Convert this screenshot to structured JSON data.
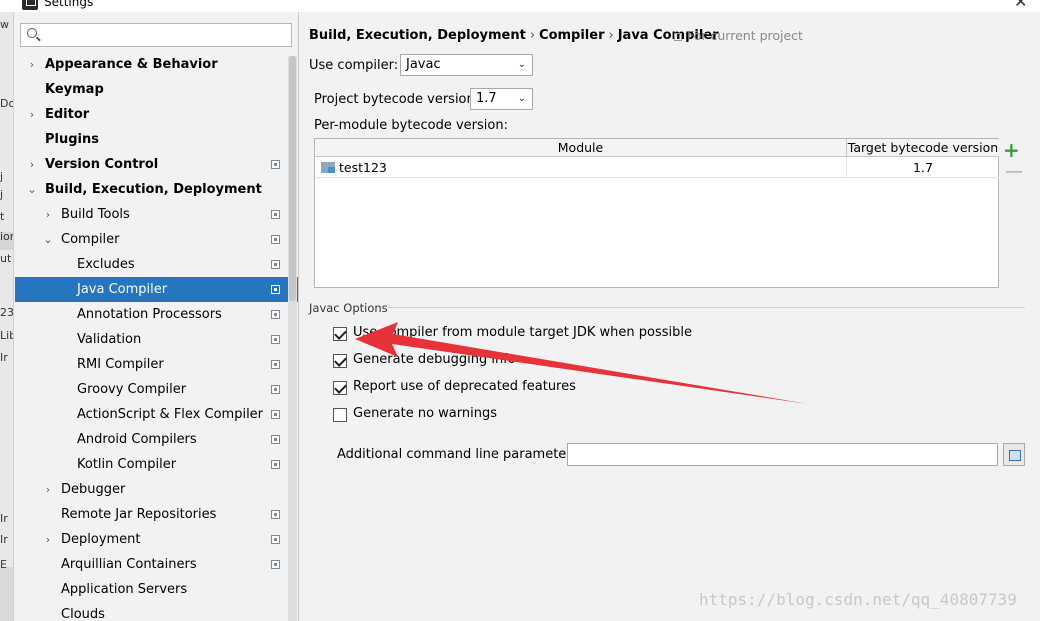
{
  "window": {
    "title": "Settings"
  },
  "search": {
    "placeholder": ""
  },
  "background_fragments": [
    "w",
    "Dom",
    "j",
    "j",
    "t",
    "ion",
    "ut",
    "23",
    "Lib",
    "Ir",
    "Ir",
    "Ir",
    "E"
  ],
  "sidebar": {
    "items": [
      {
        "label": "Appearance & Behavior",
        "bold": true,
        "chevron": "›",
        "project_icon": false
      },
      {
        "label": "Keymap",
        "bold": true,
        "chevron": "",
        "project_icon": false
      },
      {
        "label": "Editor",
        "bold": true,
        "chevron": "›",
        "project_icon": false
      },
      {
        "label": "Plugins",
        "bold": true,
        "chevron": "",
        "project_icon": false
      },
      {
        "label": "Version Control",
        "bold": true,
        "chevron": "›",
        "project_icon": true
      },
      {
        "label": "Build, Execution, Deployment",
        "bold": true,
        "chevron": "⌄",
        "project_icon": false
      },
      {
        "label": "Build Tools",
        "bold": false,
        "chevron": "›",
        "project_icon": true
      },
      {
        "label": "Compiler",
        "bold": false,
        "chevron": "⌄",
        "project_icon": true
      },
      {
        "label": "Excludes",
        "bold": false,
        "chevron": "",
        "project_icon": true
      },
      {
        "label": "Java Compiler",
        "bold": false,
        "chevron": "",
        "project_icon": true,
        "selected": true
      },
      {
        "label": "Annotation Processors",
        "bold": false,
        "chevron": "",
        "project_icon": true
      },
      {
        "label": "Validation",
        "bold": false,
        "chevron": "",
        "project_icon": true
      },
      {
        "label": "RMI Compiler",
        "bold": false,
        "chevron": "",
        "project_icon": true
      },
      {
        "label": "Groovy Compiler",
        "bold": false,
        "chevron": "",
        "project_icon": true
      },
      {
        "label": "ActionScript & Flex Compiler",
        "bold": false,
        "chevron": "",
        "project_icon": true
      },
      {
        "label": "Android Compilers",
        "bold": false,
        "chevron": "",
        "project_icon": true
      },
      {
        "label": "Kotlin Compiler",
        "bold": false,
        "chevron": "",
        "project_icon": true
      },
      {
        "label": "Debugger",
        "bold": false,
        "chevron": "›",
        "project_icon": false
      },
      {
        "label": "Remote Jar Repositories",
        "bold": false,
        "chevron": "",
        "project_icon": true
      },
      {
        "label": "Deployment",
        "bold": false,
        "chevron": "›",
        "project_icon": true
      },
      {
        "label": "Arquillian Containers",
        "bold": false,
        "chevron": "",
        "project_icon": true
      },
      {
        "label": "Application Servers",
        "bold": false,
        "chevron": "",
        "project_icon": false
      },
      {
        "label": "Clouds",
        "bold": false,
        "chevron": "",
        "project_icon": false
      }
    ]
  },
  "breadcrumb": {
    "parts": [
      "Build, Execution, Deployment",
      "Compiler",
      "Java Compiler"
    ],
    "separator": "›",
    "scope_note": "For current project"
  },
  "compiler": {
    "label": "Use compiler:",
    "value": "Javac"
  },
  "bytecode": {
    "label": "Project bytecode version:",
    "value": "1.7"
  },
  "per_module": {
    "label": "Per-module bytecode version:",
    "columns": [
      "Module",
      "Target bytecode version"
    ],
    "rows": [
      {
        "module": "test123",
        "version": "1.7"
      }
    ],
    "add_symbol": "+",
    "remove_symbol": "—"
  },
  "javac_options": {
    "title": "Javac Options",
    "options": [
      {
        "label": "Use compiler from module target JDK when possible",
        "checked": true
      },
      {
        "label": "Generate debugging info",
        "checked": true
      },
      {
        "label": "Report use of deprecated features",
        "checked": true
      },
      {
        "label": "Generate no warnings",
        "checked": false
      }
    ],
    "params_label": "Additional command line parameters:",
    "params_value": ""
  },
  "watermark": "https://blog.csdn.net/qq_40807739",
  "colors": {
    "selection": "#2675bf",
    "annotation_arrow": "#e8323a",
    "add_button": "#3b9b3b"
  }
}
